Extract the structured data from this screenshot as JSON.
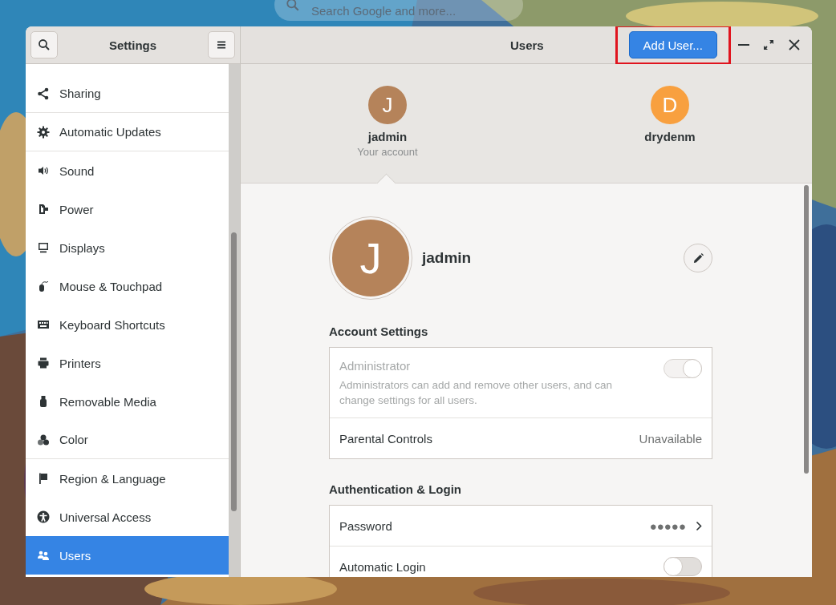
{
  "desktop_search": {
    "placeholder": "Search Google and more..."
  },
  "window": {
    "sidebar_title": "Settings",
    "title": "Users"
  },
  "add_user": {
    "label": "Add User...",
    "highlighted": true
  },
  "sidebar": {
    "items": [
      {
        "label": "Sharing",
        "selected": false,
        "divider_after": true
      },
      {
        "label": "Automatic Updates",
        "selected": false,
        "divider_after": true
      },
      {
        "label": "Sound",
        "selected": false,
        "divider_after": false
      },
      {
        "label": "Power",
        "selected": false,
        "divider_after": false
      },
      {
        "label": "Displays",
        "selected": false,
        "divider_after": false
      },
      {
        "label": "Mouse & Touchpad",
        "selected": false,
        "divider_after": false
      },
      {
        "label": "Keyboard Shortcuts",
        "selected": false,
        "divider_after": false
      },
      {
        "label": "Printers",
        "selected": false,
        "divider_after": false
      },
      {
        "label": "Removable Media",
        "selected": false,
        "divider_after": false
      },
      {
        "label": "Color",
        "selected": false,
        "divider_after": true
      },
      {
        "label": "Region & Language",
        "selected": false,
        "divider_after": false
      },
      {
        "label": "Universal Access",
        "selected": false,
        "divider_after": false
      },
      {
        "label": "Users",
        "selected": true,
        "divider_after": false
      }
    ]
  },
  "users": [
    {
      "initial": "J",
      "name": "jadmin",
      "note": "Your account",
      "color": "#b5835a",
      "selected": true
    },
    {
      "initial": "D",
      "name": "drydenm",
      "color": "#f8a03f",
      "selected": false
    }
  ],
  "profile": {
    "initial": "J",
    "name": "jadmin"
  },
  "sections": [
    {
      "heading": "Account Settings",
      "rows": [
        {
          "kind": "switch",
          "label": "Administrator",
          "description": "Administrators can add and remove other users, and can change settings for all users.",
          "on": true,
          "disabled": true
        },
        {
          "kind": "value",
          "label": "Parental Controls",
          "value": "Unavailable"
        }
      ]
    },
    {
      "heading": "Authentication & Login",
      "rows": [
        {
          "kind": "link",
          "label": "Password",
          "value": "●●●●●"
        },
        {
          "kind": "switch",
          "label": "Automatic Login",
          "on": false
        }
      ]
    }
  ]
}
